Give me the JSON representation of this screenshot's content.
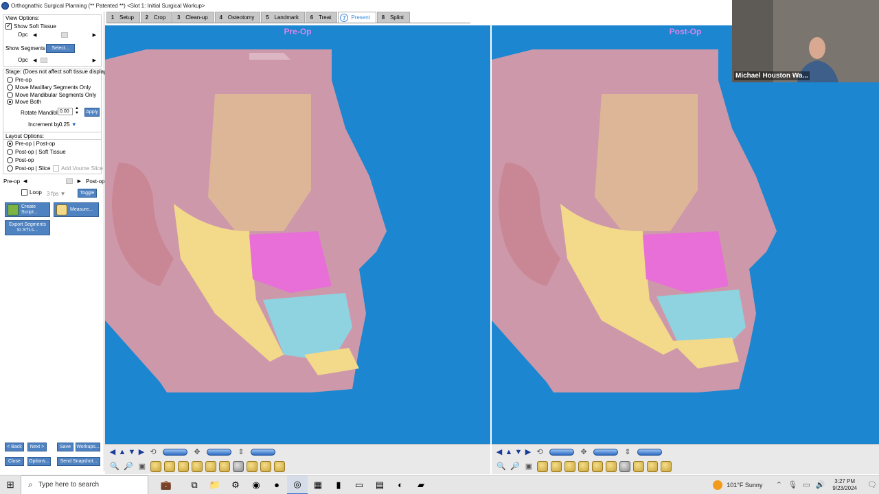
{
  "window": {
    "title": "Orthognathic Surgical Planning (** Patented **) <Slot 1: Initial Surgical Workup>"
  },
  "tabs": [
    {
      "num": "1",
      "label": "Setup"
    },
    {
      "num": "2",
      "label": "Crop"
    },
    {
      "num": "3",
      "label": "Clean-up"
    },
    {
      "num": "4",
      "label": "Osteotomy"
    },
    {
      "num": "5",
      "label": "Landmark"
    },
    {
      "num": "6",
      "label": "Treat"
    },
    {
      "num": "7",
      "label": "Present",
      "active": true
    },
    {
      "num": "8",
      "label": "Splint"
    }
  ],
  "sidebar": {
    "view_options": {
      "heading": "View Options:",
      "show_soft_tissue_label": "Show Soft Tissue",
      "opc_label": "Opc",
      "show_segments_label": "Show Segments:",
      "select_button": "Select...",
      "opc2_label": "Opc"
    },
    "stage": {
      "heading": "Stage: (Does not affect soft tissue display)",
      "options": [
        "Pre-op",
        "Move Maxillary Segments Only",
        "Move Mandibular Segments Only",
        "Move Both"
      ],
      "selected": "Move Both",
      "rotate_mandible_label": "Rotate Mandible",
      "rotate_mandible_value": "0.00",
      "apply_button": "Apply",
      "increment_label": "Increment by",
      "increment_value": "0.25"
    },
    "layout": {
      "heading": "Layout Options:",
      "options": [
        "Pre-op | Post-op",
        "Post-op | Soft Tissue",
        "Post-op",
        "Post-op | Slice"
      ],
      "selected": "Pre-op | Post-op",
      "add_volume_slice_label": "Add Voume Slice"
    },
    "animation": {
      "preop_label": "Pre-op",
      "postop_label": "Post-op",
      "loop_label": "Loop",
      "fps_value": "3 fps",
      "toggle_button": "Toggle"
    },
    "create_script_button": "Create Script...",
    "measure_button": "Measure...",
    "export_button": "Export Segments to STLs...",
    "nav": {
      "back": "< Back",
      "next": "Next >",
      "save": "Save",
      "workups": "Workups...",
      "close": "Close",
      "options": "Options...",
      "send_snapshot": "Send Snapshot..."
    }
  },
  "viewports": {
    "pre": {
      "title": "Pre-Op"
    },
    "post": {
      "title": "Post-Op"
    }
  },
  "webcam": {
    "name": "Michael Houston Wa..."
  },
  "taskbar": {
    "search_placeholder": "Type here to search",
    "weather": "101°F  Sunny",
    "time": "3:27 PM",
    "date": "9/23/2024"
  },
  "colors": {
    "viewport_bg": "#1c86d0",
    "viewport_title": "#d986e8",
    "soft_tissue": "#d79aa8",
    "mandible": "#f3d98a",
    "maxilla": "#e76fd7",
    "lower_teeth": "#8fd2e0"
  }
}
